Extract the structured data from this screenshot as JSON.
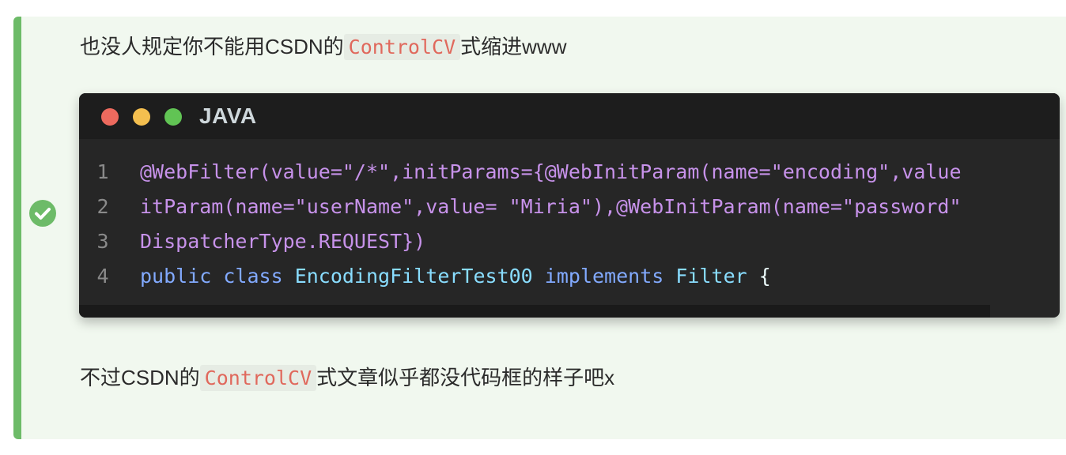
{
  "callout": {
    "intro_before": "也没人规定你不能用CSDN的",
    "intro_code": "ControlCV",
    "intro_after": "式缩进www",
    "outro_before": "不过CSDN的",
    "outro_code": "ControlCV",
    "outro_after": "式文章似乎都没代码框的样子吧x",
    "icon": "check-circle-icon"
  },
  "code_block": {
    "language": "JAVA",
    "lines": [
      {
        "number": "1",
        "text": "@WebFilter(value=\"/*\",initParams={@WebInitParam(name=\"encoding\",value"
      },
      {
        "number": "2",
        "text": "itParam(name=\"userName\",value= \"Miria\"),@WebInitParam(name=\"password\""
      },
      {
        "number": "3",
        "text": "DispatcherType.REQUEST})"
      },
      {
        "number": "4",
        "kw1": "public",
        "kw2": "class",
        "name": "EncodingFilterTest00",
        "kw3": "implements",
        "iface": "Filter",
        "brace": "{"
      }
    ]
  },
  "colors": {
    "accent": "#6dbb68",
    "callout_bg": "#f1f8ef",
    "code_bg": "#262626",
    "inline_code": "#e0685c"
  }
}
